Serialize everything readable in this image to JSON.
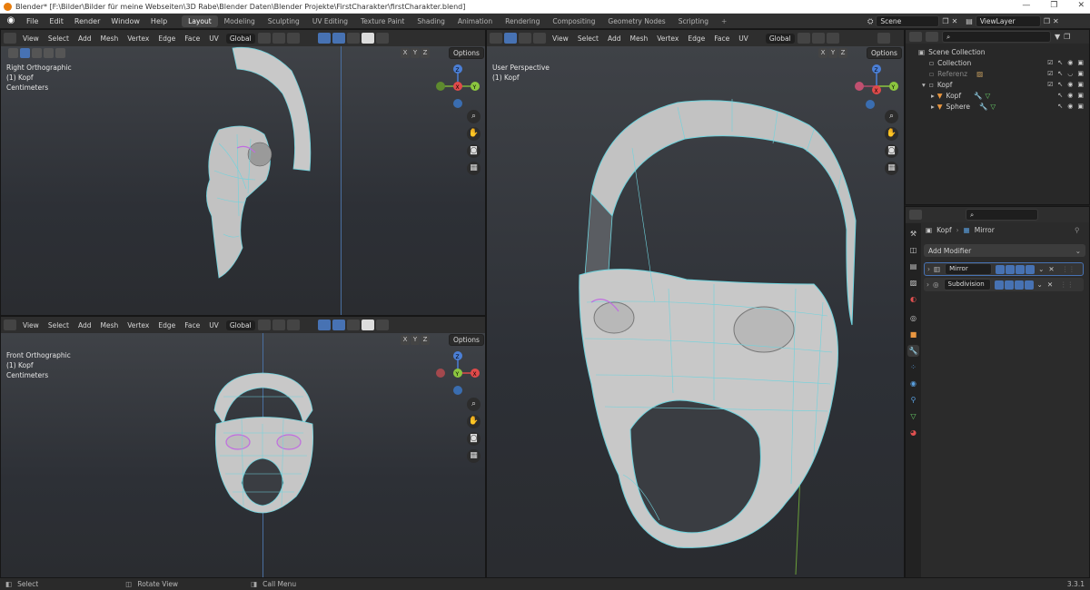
{
  "window": {
    "title": "Blender* [F:\\Bilder\\Bilder für meine Webseiten\\3D Rabe\\Blender Daten\\Blender Projekte\\FirstCharakter\\firstCharakter.blend]"
  },
  "menu": [
    "File",
    "Edit",
    "Render",
    "Window",
    "Help"
  ],
  "workspaces": [
    "Layout",
    "Modeling",
    "Sculpting",
    "UV Editing",
    "Texture Paint",
    "Shading",
    "Animation",
    "Rendering",
    "Compositing",
    "Geometry Nodes",
    "Scripting"
  ],
  "scene": {
    "label": "Scene",
    "view_layer": "ViewLayer"
  },
  "viewport_menu": [
    "View",
    "Select",
    "Add",
    "Mesh",
    "Vertex",
    "Edge",
    "Face",
    "UV"
  ],
  "transform": {
    "orientation": "Global"
  },
  "axes": [
    "X",
    "Y",
    "Z"
  ],
  "options_label": "Options",
  "viewports": {
    "top_left": {
      "view": "Right Orthographic",
      "object": "(1) Kopf",
      "units": "Centimeters"
    },
    "bottom_left": {
      "view": "Front Orthographic",
      "object": "(1) Kopf",
      "units": "Centimeters"
    },
    "right": {
      "view": "User Perspective",
      "object": "(1) Kopf"
    }
  },
  "outliner": {
    "root": "Scene Collection",
    "items": [
      {
        "name": "Collection",
        "level": 1
      },
      {
        "name": "Referenz",
        "level": 1
      },
      {
        "name": "Kopf",
        "level": 1
      },
      {
        "name": "Kopf",
        "level": 2
      },
      {
        "name": "Sphere",
        "level": 2
      }
    ]
  },
  "properties": {
    "object": "Kopf",
    "modifier_breadcrumb": "Mirror",
    "add_modifier": "Add Modifier",
    "modifiers": [
      "Mirror",
      "Subdivision"
    ]
  },
  "status": {
    "select": "Select",
    "rotate": "Rotate View",
    "call_menu": "Call Menu",
    "version": "3.3.1"
  },
  "colors": {
    "accent": "#4772b3",
    "workspace_active": "#474747",
    "mesh_wire": "#6fd3dd",
    "mesh_face": "#c9c9c9"
  }
}
